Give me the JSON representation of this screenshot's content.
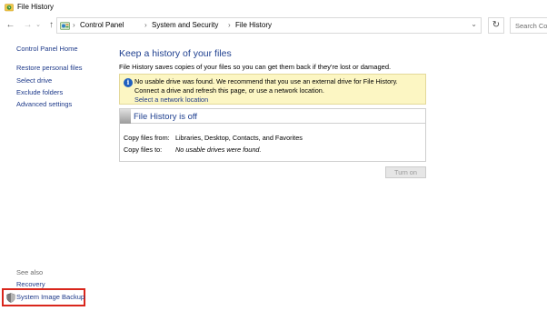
{
  "window": {
    "title": "File History"
  },
  "nav": {
    "back_glyph": "←",
    "forward_glyph": "→",
    "recent_glyph": "⌄",
    "up_glyph": "↑",
    "refresh_glyph": "↻",
    "search_placeholder": "Search Con"
  },
  "address": {
    "breadcrumbs": [
      "Control Panel",
      "System and Security",
      "File History"
    ],
    "separator": "›",
    "dropdown_glyph": "⌄"
  },
  "sidebar": {
    "home": "Control Panel Home",
    "items": [
      "Restore personal files",
      "Select drive",
      "Exclude folders",
      "Advanced settings"
    ],
    "see_also_label": "See also",
    "see_also_items": [
      "Recovery",
      "System Image Backup"
    ]
  },
  "main": {
    "heading": "Keep a history of your files",
    "description": "File History saves copies of your files so you can get them back if they're lost or damaged.",
    "warning": {
      "icon": "info-icon",
      "icon_glyph": "i",
      "text": "No usable drive was found. We recommend that you use an external drive for File History. Connect a drive and refresh this page, or use a network location.",
      "link": "Select a network location"
    },
    "status": {
      "title": "File History is off",
      "copy_from_label": "Copy files from:",
      "copy_from_value": "Libraries, Desktop, Contacts, and Favorites",
      "copy_to_label": "Copy files to:",
      "copy_to_value": "No usable drives were found."
    },
    "turn_on_label": "Turn on"
  },
  "colors": {
    "link": "#1e3a8a",
    "heading": "#1e3f8f",
    "warning_bg": "#fcf6c3",
    "highlight_border": "#d9261c"
  }
}
